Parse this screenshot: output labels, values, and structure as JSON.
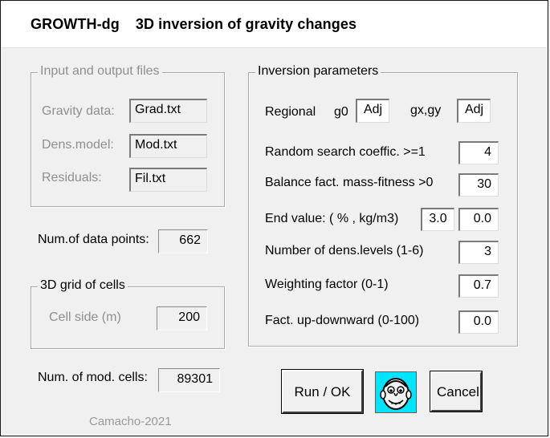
{
  "window": {
    "app_name": "GROWTH-dg",
    "title_text": "3D inversion of gravity changes"
  },
  "files": {
    "legend": "Input and output files",
    "gravity_label": "Gravity data:",
    "gravity_value": "Grad.txt",
    "dens_label": "Dens.model:",
    "dens_value": "Mod.txt",
    "residuals_label": "Residuals:",
    "residuals_value": "Fil.txt"
  },
  "data_points": {
    "label": "Num.of data points:",
    "value": "662"
  },
  "grid": {
    "legend": "3D grid of cells",
    "cell_side_label": "Cell side (m)",
    "cell_side_value": "200"
  },
  "mod_cells": {
    "label": "Num. of mod. cells:",
    "value": "89301"
  },
  "params": {
    "legend": "Inversion parameters",
    "regional_label": "Regional",
    "g0_label": "g0",
    "g0_value": "Adj",
    "gxgy_label": "gx,gy",
    "gxgy_value": "Adj",
    "random_label": "Random search coeffic. >=1",
    "random_value": "4",
    "balance_label": "Balance fact. mass-fitness >0",
    "balance_value": "30",
    "end_label": "End value: ( % ,  kg/m3)",
    "end_value_pct": "3.0",
    "end_value_kg": "0.0",
    "levels_label": "Number of dens.levels (1-6)",
    "levels_value": "3",
    "weight_label": "Weighting factor (0-1)",
    "weight_value": "0.7",
    "updown_label": "Fact. up-downward (0-100)",
    "updown_value": "0.0"
  },
  "buttons": {
    "run_label": "Run / OK",
    "cancel_label": "Cancel"
  },
  "face_icon": "smiley-face-icon",
  "colors": {
    "face_background": "#00e5ff",
    "dialog_background": "#f0f0f0",
    "disabled_text": "#8f8f8f"
  },
  "credit": "Camacho-2021"
}
